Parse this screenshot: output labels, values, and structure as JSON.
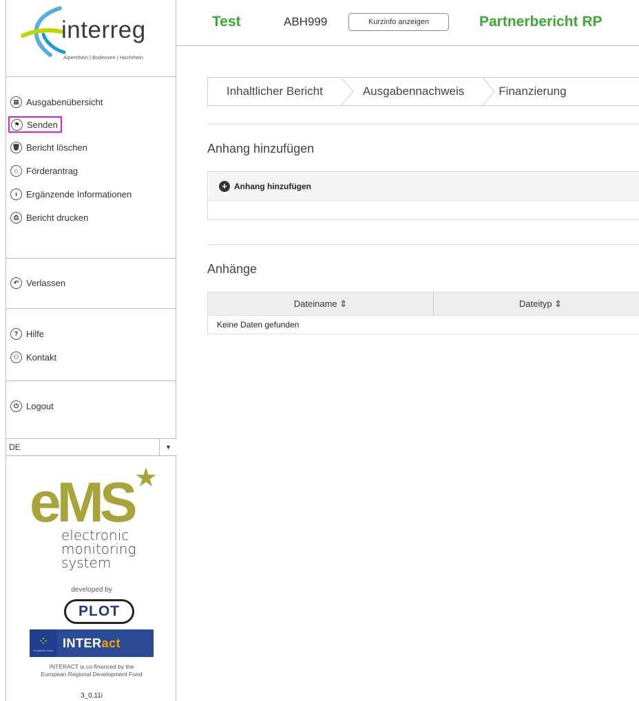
{
  "sidebar": {
    "logo": {
      "word": "interreg",
      "subtitle": "Alpenrhein | Bodensee | Hochrhein"
    },
    "menu": [
      {
        "label": "Ausgabenübersicht",
        "icon": "grid-icon"
      },
      {
        "label": "Senden",
        "icon": "flag-icon",
        "active": true
      },
      {
        "label": "Bericht löschen",
        "icon": "trash-icon"
      },
      {
        "label": "Förderantrag",
        "icon": "building-icon"
      },
      {
        "label": "Ergänzende Informationen",
        "icon": "info-icon"
      },
      {
        "label": "Bericht drucken",
        "icon": "printer-icon"
      }
    ],
    "leave": {
      "label": "Verlassen",
      "icon": "back-arrow-icon"
    },
    "help": [
      {
        "label": "Hilfe",
        "icon": "question-icon"
      },
      {
        "label": "Kontakt",
        "icon": "contact-icon"
      }
    ],
    "logout": {
      "label": "Logout",
      "icon": "power-icon"
    },
    "language": "DE",
    "ems": {
      "logo": "eMS",
      "line1": "electronic",
      "line2": "monitoring",
      "line3": "system",
      "developed_by": "developed by",
      "plot": "PLOT",
      "interact_prefix": "INTER",
      "interact_suffix": "act",
      "eu_label": "European Union",
      "cofinanced_1": "INTERACT is co-financed by the",
      "cofinanced_2": "European Regional Development Fund",
      "version": "3_0.11i"
    }
  },
  "header": {
    "project": "Test",
    "code": "ABH999",
    "info_button": "Kurzinfo anzeigen",
    "title": "Partnerbericht RP"
  },
  "steps": [
    "Inhaltlicher Bericht",
    "Ausgabennachweis",
    "Finanzierung"
  ],
  "attach_section": {
    "title": "Anhang hinzufügen",
    "add_label": "Anhang hinzufügen"
  },
  "attachments": {
    "title": "Anhänge",
    "columns": [
      "Dateiname ⇕",
      "Dateityp ⇕"
    ],
    "empty": "Keine Daten gefunden"
  },
  "colors": {
    "brand_green": "#3aaa35",
    "highlight": "#e020c8",
    "ems_olive": "#a9a33c",
    "interact_blue": "#2b4a96"
  }
}
